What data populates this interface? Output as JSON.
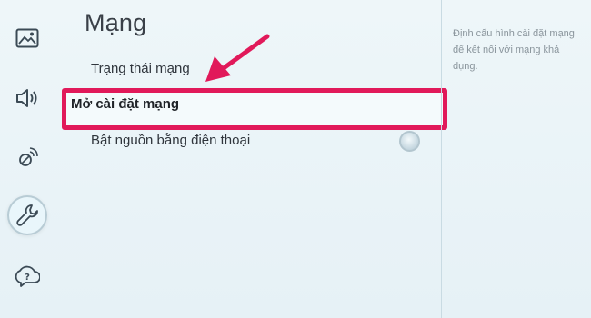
{
  "page": {
    "title": "Mạng",
    "description": "Định cấu hình cài đặt mạng để kết nối với mạng khả dụng."
  },
  "menu": {
    "items": [
      {
        "label": "Trạng thái mạng"
      },
      {
        "label": "Mở cài đặt mạng",
        "highlighted": true
      },
      {
        "label": "Bật nguồn bằng điện thoại",
        "toggle": "off"
      }
    ]
  },
  "sidebar": {
    "items": [
      {
        "icon": "picture-icon"
      },
      {
        "icon": "sound-icon"
      },
      {
        "icon": "broadcast-icon"
      },
      {
        "icon": "wrench-icon",
        "selected": true
      },
      {
        "icon": "support-icon"
      }
    ]
  },
  "colors": {
    "highlight": "#e1195a",
    "arrow": "#e1195a",
    "background": "#eaf4f8"
  }
}
